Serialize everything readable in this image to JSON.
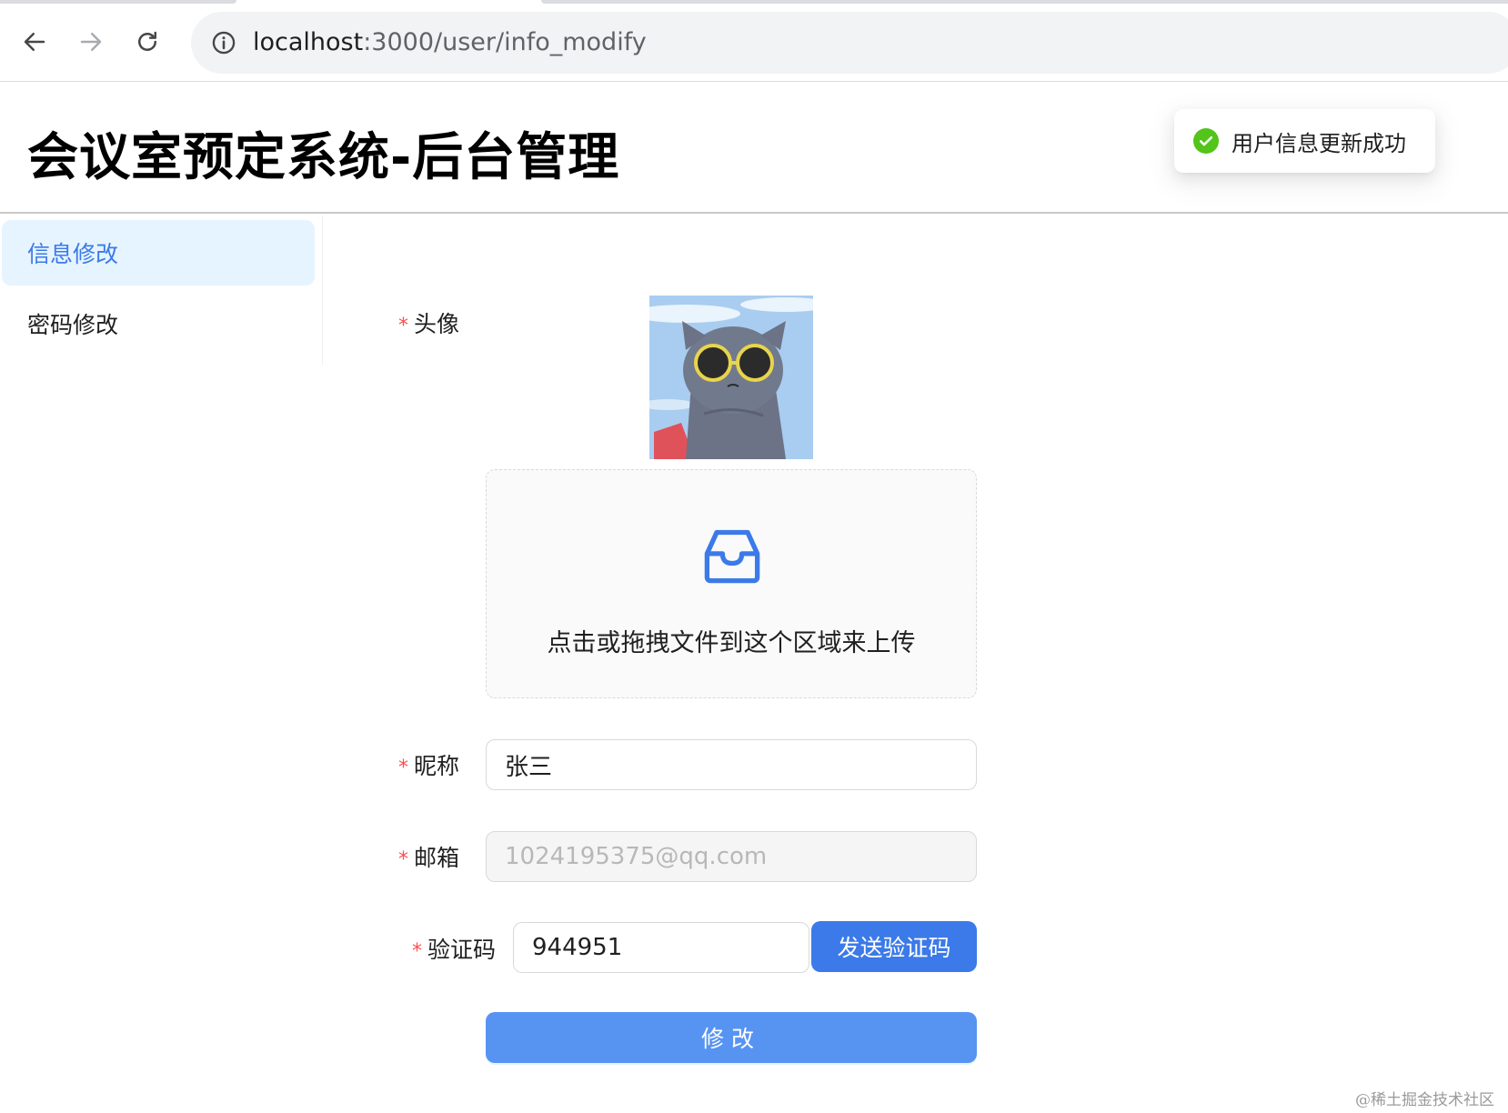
{
  "browser": {
    "url_host": "localhost",
    "url_path": ":3000/user/info_modify",
    "back_icon": "arrow-left-icon",
    "forward_icon": "arrow-right-icon",
    "reload_icon": "reload-icon",
    "info_icon": "info-icon"
  },
  "header": {
    "title": "会议室预定系统-后台管理"
  },
  "toast": {
    "message": "用户信息更新成功",
    "icon": "check-circle-icon",
    "color": "#52c41a"
  },
  "sidebar": {
    "items": [
      {
        "label": "信息修改",
        "active": true
      },
      {
        "label": "密码修改",
        "active": false
      }
    ]
  },
  "form": {
    "required_mark": "*",
    "avatar_label": "头像",
    "upload_hint": "点击或拖拽文件到这个区域来上传",
    "upload_icon": "inbox-icon",
    "nickname_label": "昵称",
    "nickname_value": "张三",
    "email_label": "邮箱",
    "email_value": "1024195375@qq.com",
    "captcha_label": "验证码",
    "captcha_value": "944951",
    "send_code_label": "发送验证码",
    "submit_label": "修改"
  },
  "colors": {
    "primary": "#3b7ae8",
    "submit": "#5794f2",
    "active_menu_bg": "#e6f4ff",
    "required": "#ff4d4f"
  },
  "watermark": "@稀土掘金技术社区"
}
